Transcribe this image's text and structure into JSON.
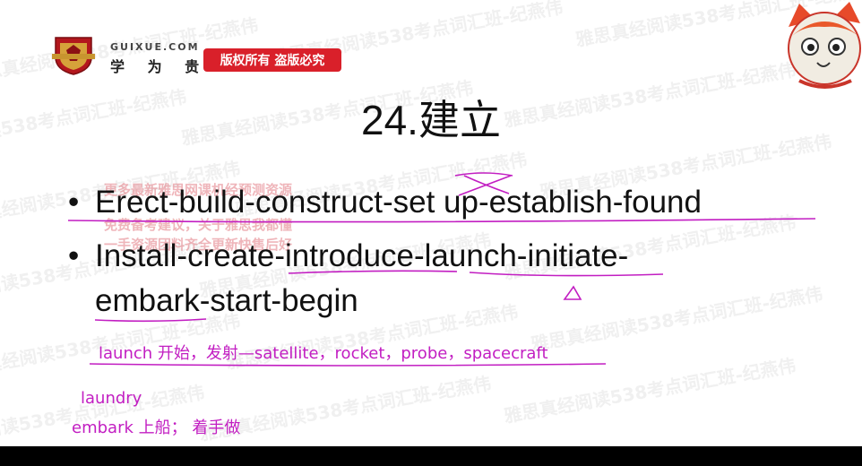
{
  "header": {
    "site": "GUIXUE.COM",
    "brand": "学 为 贵",
    "copyright_badge": "版权所有 盗版必究"
  },
  "slide": {
    "title": "24.建立",
    "bullet_symbol": "•",
    "bullets": [
      "Erect-build-construct-set up-establish-found",
      "Install-create-introduce-launch-initiate-",
      "embark-start-begin"
    ]
  },
  "notes": [
    "launch 开始，发射—satellite，rocket，probe，spacecraft",
    "laundry",
    "embark 上船； 着手做"
  ],
  "watermarks": {
    "repeat": "雅思真经阅读538考点词汇班-纪燕伟",
    "pink_overlay": [
      "更多最新雅思网课机经预测资源",
      "免费备考建议，关于雅思我都懂",
      "一手资源团料齐全更新快售后好"
    ]
  },
  "colors": {
    "annotation_ink": "#c21ec2",
    "badge_red": "#d9202a",
    "text": "#111111"
  }
}
